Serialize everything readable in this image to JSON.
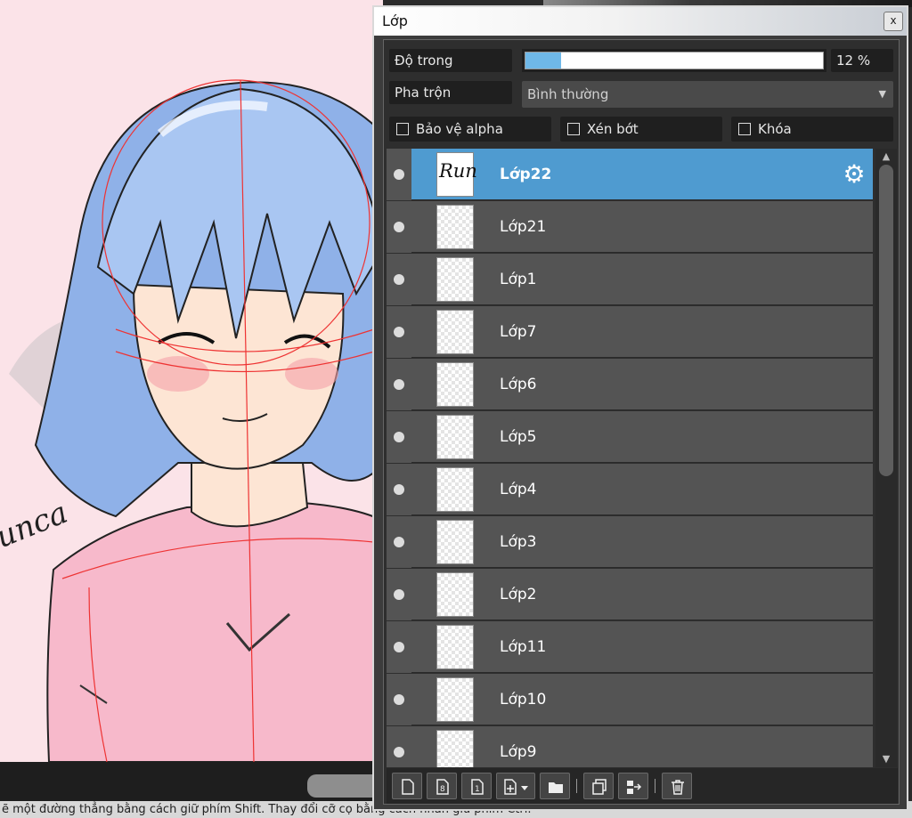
{
  "canvas": {
    "signature_text": "unca"
  },
  "status_bar": {
    "text": "ẽ một đường thẳng bằng cách giữ phím Shift. Thay đổi cỡ cọ bằng cách nhấn giữ phím Ctrl."
  },
  "layer_panel": {
    "title": "Lớp",
    "close_label": "x",
    "opacity": {
      "label": "Độ trong",
      "value_text": "12 %",
      "value": 0.12
    },
    "blend": {
      "label": "Pha trộn",
      "selected": "Bình thường"
    },
    "checkboxes": {
      "protect_alpha": "Bảo vệ alpha",
      "clip": "Xén bớt",
      "lock": "Khóa"
    },
    "layers": [
      {
        "name": "Lớp22",
        "selected": true,
        "thumb_text": "Run"
      },
      {
        "name": "Lớp21",
        "selected": false
      },
      {
        "name": "Lớp1",
        "selected": false
      },
      {
        "name": "Lớp7",
        "selected": false
      },
      {
        "name": "Lớp6",
        "selected": false
      },
      {
        "name": "Lớp5",
        "selected": false
      },
      {
        "name": "Lớp4",
        "selected": false
      },
      {
        "name": "Lớp3",
        "selected": false
      },
      {
        "name": "Lớp2",
        "selected": false
      },
      {
        "name": "Lớp11",
        "selected": false
      },
      {
        "name": "Lớp10",
        "selected": false
      },
      {
        "name": "Lớp9",
        "selected": false
      }
    ],
    "toolbar_icons": [
      "new-layer-icon",
      "new-8bit-layer-icon",
      "new-1bit-layer-icon",
      "add-layer-menu-icon",
      "new-folder-icon",
      "duplicate-layer-icon",
      "merge-down-icon",
      "delete-layer-icon"
    ]
  },
  "colors": {
    "selected_layer": "#4f9bd0",
    "opacity_fill": "#6fb8e8",
    "canvas_bg": "#fbe3e8",
    "hair": "#8fb1e8",
    "shirt": "#f7b9cb"
  }
}
